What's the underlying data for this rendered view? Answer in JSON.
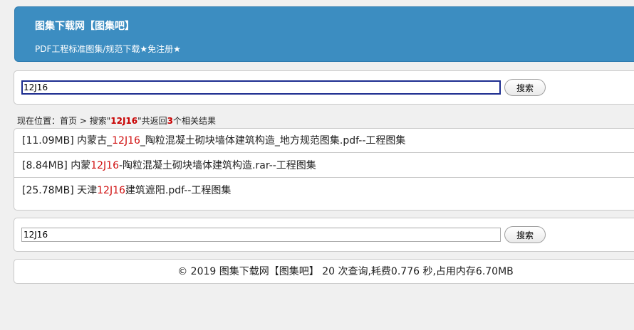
{
  "header": {
    "title": "图集下载网【图集吧】",
    "subtitle": "PDF工程标准图集/规范下载★免注册★"
  },
  "search_top": {
    "value": "12J16",
    "button_label": "搜索"
  },
  "breadcrumb": {
    "prefix": "现在位置：",
    "home": "首页",
    "separator": " > ",
    "search_label": "搜索\"",
    "keyword": "12J16",
    "mid": "\"共返回",
    "count": "3",
    "suffix": "个相关结果"
  },
  "results": [
    {
      "pre": "[11.09MB] 内蒙古_",
      "kw": "12J16",
      "post": "_陶粒混凝土砌块墙体建筑构造_地方规范图集.pdf--工程图集"
    },
    {
      "pre": "[8.84MB] 内蒙",
      "kw": "12J16",
      "post": "-陶粒混凝土砌块墙体建筑构造.rar--工程图集"
    },
    {
      "pre": "[25.78MB] 天津",
      "kw": "12J16",
      "post": "建筑遮阳.pdf--工程图集"
    }
  ],
  "search_bottom": {
    "value": "12J16",
    "button_label": "搜索"
  },
  "footer": {
    "text": "© 2019  图集下载网【图集吧】  20 次查询,耗费0.776 秒,占用内存6.70MB"
  }
}
